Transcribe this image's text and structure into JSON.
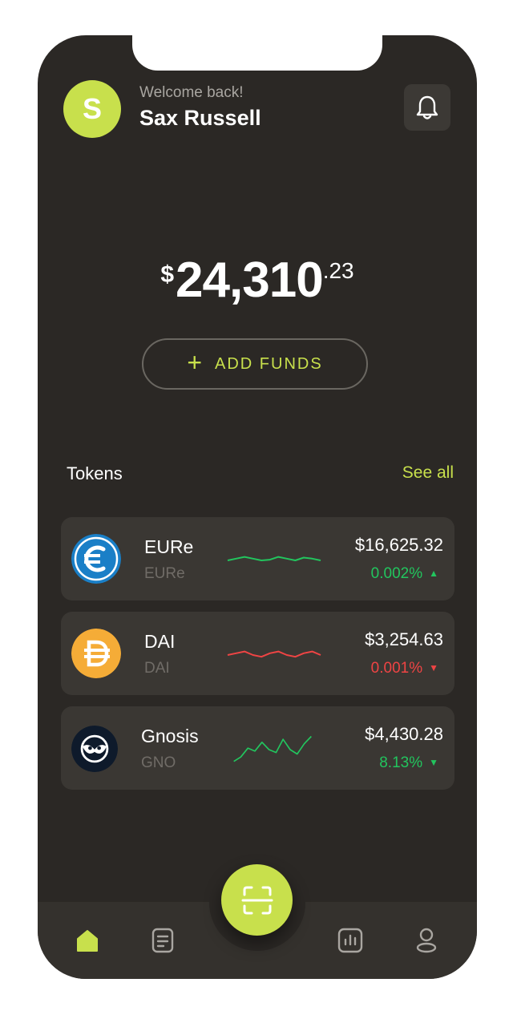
{
  "header": {
    "avatar_initial": "S",
    "welcome": "Welcome back!",
    "username": "Sax Russell",
    "bell_icon": "bell-icon"
  },
  "balance": {
    "currency": "$",
    "main": "24,310",
    "cents": ".23"
  },
  "add_funds": {
    "icon": "plus-icon",
    "label": "ADD FUNDS"
  },
  "tokens": {
    "title": "Tokens",
    "see_all": "See all",
    "items": [
      {
        "name": "EURe",
        "symbol": "EURe",
        "price": "$16,625.32",
        "change": "0.002%",
        "direction": "up",
        "trend_color": "#22c55e",
        "icon": "euro-coin-icon",
        "icon_color": "#1a7fc7",
        "sparkline": [
          0.5,
          0.55,
          0.6,
          0.55,
          0.5,
          0.52,
          0.6,
          0.55,
          0.5,
          0.58,
          0.55,
          0.5
        ]
      },
      {
        "name": "DAI",
        "symbol": "DAI",
        "price": "$3,254.63",
        "change": "0.001%",
        "direction": "down",
        "trend_color": "#ef4444",
        "icon": "dai-coin-icon",
        "icon_color": "#f5ac37",
        "sparkline": [
          0.5,
          0.55,
          0.6,
          0.5,
          0.45,
          0.55,
          0.6,
          0.5,
          0.45,
          0.55,
          0.6,
          0.5
        ]
      },
      {
        "name": "Gnosis",
        "symbol": "GNO",
        "price": "$4,430.28",
        "change": "8.13%",
        "direction": "down",
        "trend_color": "#22c55e",
        "icon": "gnosis-owl-icon",
        "icon_color": "#0e1a2b",
        "sparkline": [
          0.1,
          0.25,
          0.55,
          0.45,
          0.75,
          0.5,
          0.4,
          0.85,
          0.5,
          0.35,
          0.7,
          0.95
        ]
      }
    ]
  },
  "nav": {
    "items": [
      "home-icon",
      "document-icon",
      "chart-icon",
      "profile-icon"
    ],
    "active_color": "#c8e04c",
    "scan_icon": "scan-icon"
  },
  "colors": {
    "accent": "#c8e04c",
    "background": "#2b2825",
    "card": "#3a3733"
  }
}
